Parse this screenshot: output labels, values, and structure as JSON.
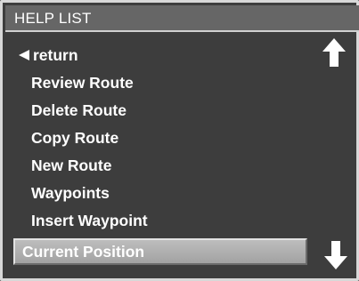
{
  "header": {
    "title": "HELP LIST"
  },
  "menu": {
    "items": [
      {
        "label": "return",
        "type": "return"
      },
      {
        "label": "Review Route"
      },
      {
        "label": "Delete Route"
      },
      {
        "label": "Copy Route"
      },
      {
        "label": "New Route"
      },
      {
        "label": "Waypoints"
      },
      {
        "label": "Insert Waypoint"
      },
      {
        "label": "Current Position",
        "selected": true
      }
    ]
  },
  "icons": {
    "scroll_up": "arrow-up-icon",
    "scroll_down": "arrow-down-icon",
    "return": "left-triangle-icon"
  },
  "colors": {
    "background": "#3d3d3d",
    "header": "#666666",
    "selected": "#b0b0b0",
    "text": "#ffffff"
  }
}
